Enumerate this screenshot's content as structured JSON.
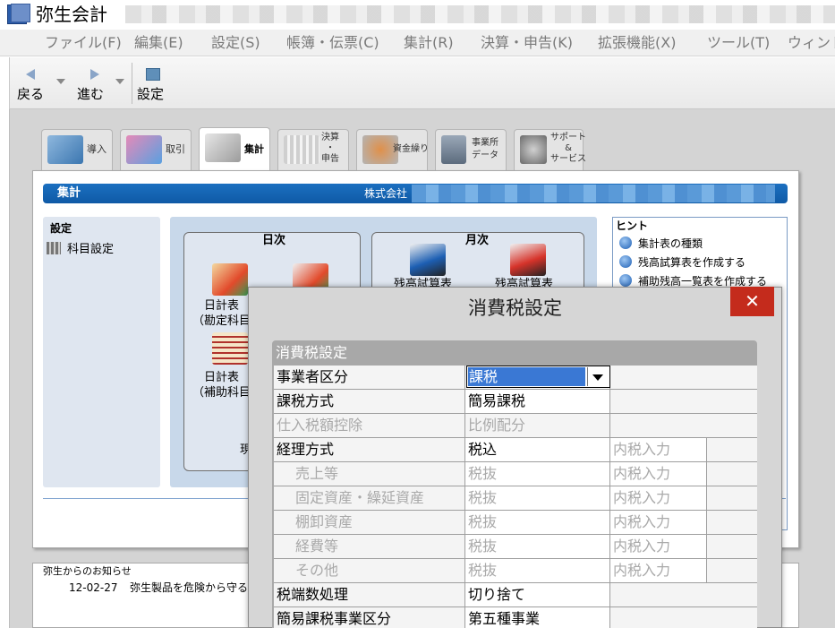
{
  "window": {
    "title": "弥生会計",
    "app_icon_text": "弥生"
  },
  "menu": [
    "ファイル(F)",
    "編集(E)",
    "設定(S)",
    "帳簿・伝票(C)",
    "集計(R)",
    "決算・申告(K)",
    "拡張機能(X)",
    "ツール(T)",
    "ウィンドウ"
  ],
  "toolbar": {
    "back": "戻る",
    "forward": "進む",
    "settings": "設定"
  },
  "tabs": [
    {
      "label": "導入"
    },
    {
      "label": "取引"
    },
    {
      "label": "集計"
    },
    {
      "label": "決算\n・\n申告"
    },
    {
      "label": "資金繰り"
    },
    {
      "label": "事業所\nデータ"
    },
    {
      "label": "サポート\n&\nサービス"
    }
  ],
  "panel": {
    "title": "集計",
    "company_prefix": "株式会社",
    "settings_title": "設定",
    "settings_item": "科目設定",
    "daily_title": "日次",
    "monthly_title": "月次",
    "daily_report1": "日計表\n（勘定科目",
    "daily_report2": "日計表\n（補助科目",
    "monthly_report1": "残高試算表",
    "monthly_report2": "残高試算表",
    "cut_label": "現"
  },
  "hints": {
    "title": "ヒント",
    "items": [
      "集計表の種類",
      "残高試算表を作成する",
      "補助残高一覧表を作成する"
    ]
  },
  "news": {
    "title": "弥生からのお知らせ",
    "date": "12-02-27",
    "text": "弥生製品を危険から守る"
  },
  "dialog": {
    "title": "消費税設定",
    "close": "✕",
    "section": "消費税設定",
    "rows": [
      {
        "label": "事業者区分",
        "value": "課税"
      },
      {
        "label": "課税方式",
        "value": "簡易課税"
      },
      {
        "label": "仕入税額控除",
        "value": "比例配分"
      },
      {
        "label": "経理方式",
        "value": "税込",
        "sub": "内税入力"
      },
      {
        "label": "売上等",
        "value": "税抜",
        "sub": "内税入力"
      },
      {
        "label": "固定資産・繰延資産",
        "value": "税抜",
        "sub": "内税入力"
      },
      {
        "label": "棚卸資産",
        "value": "税抜",
        "sub": "内税入力"
      },
      {
        "label": "経費等",
        "value": "税抜",
        "sub": "内税入力"
      },
      {
        "label": "その他",
        "value": "税抜",
        "sub": "内税入力"
      },
      {
        "label": "税端数処理",
        "value": "切り捨て"
      },
      {
        "label": "簡易課税事業区分",
        "value": "第五種事業"
      }
    ]
  }
}
